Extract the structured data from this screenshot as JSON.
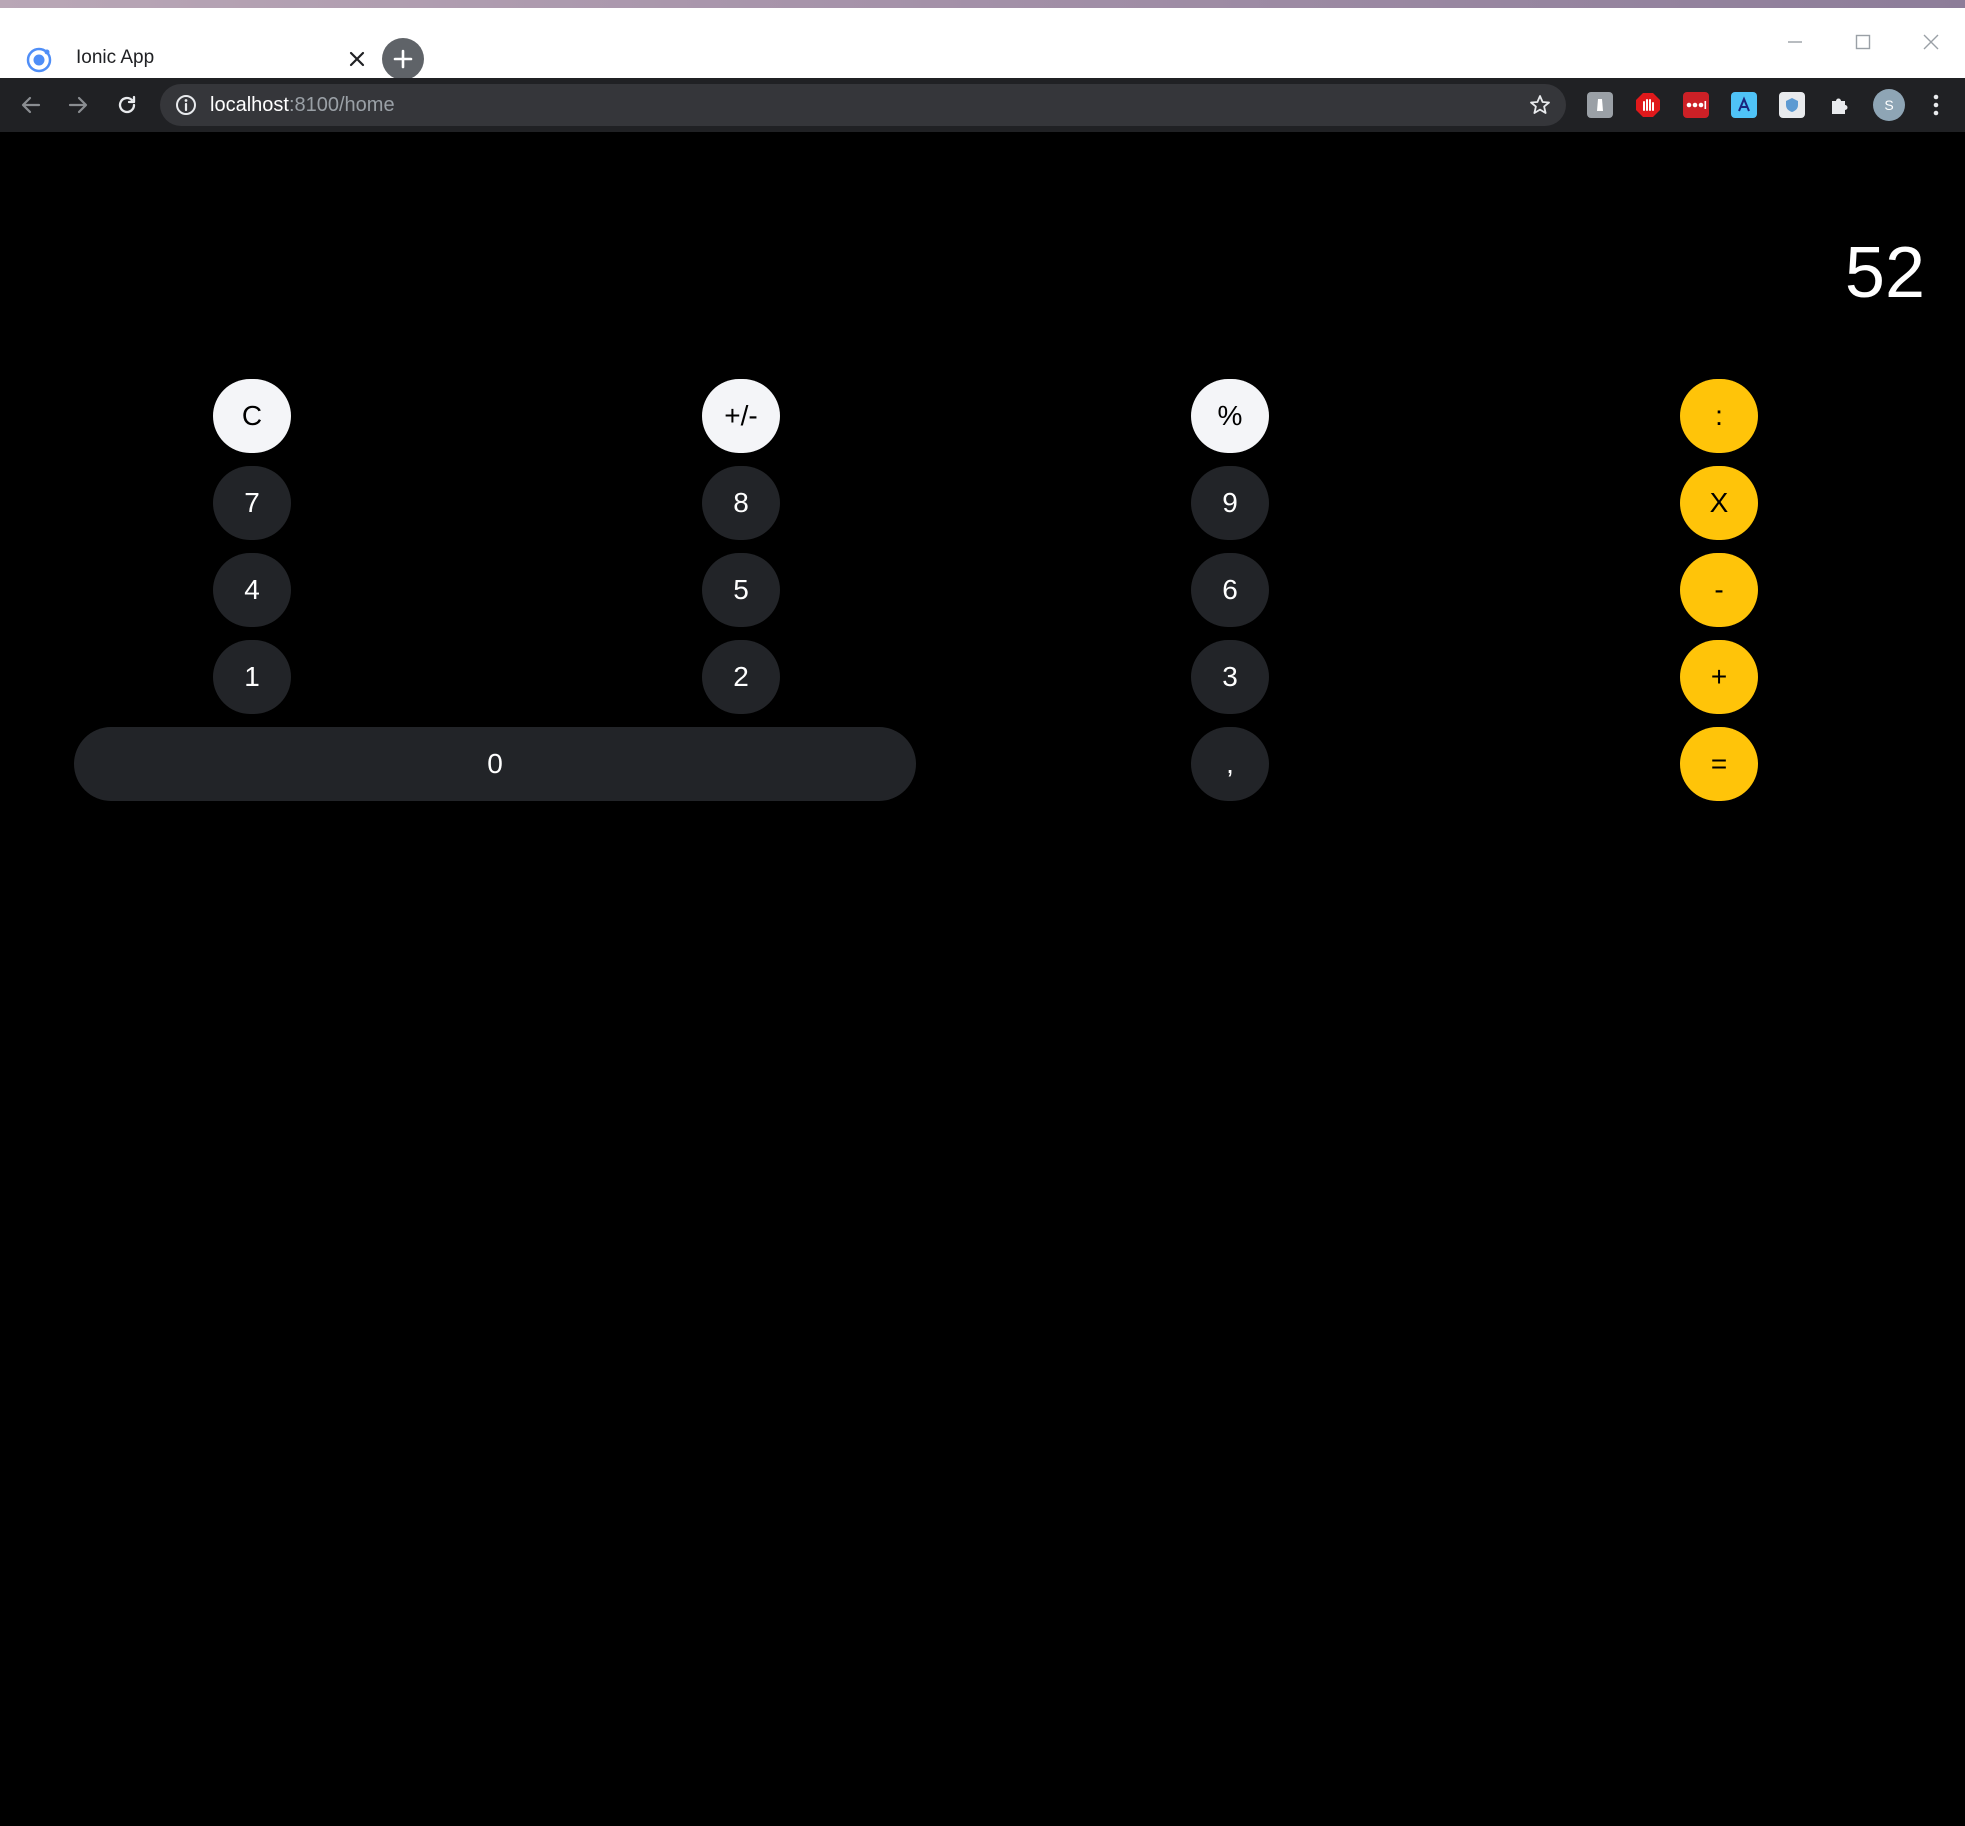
{
  "browser": {
    "tab_title": "Ionic App",
    "url_host": "localhost",
    "url_rest": ":8100/home",
    "profile_initial": "S",
    "extensions": [
      "lighthouse-icon",
      "adblock-icon",
      "lastpass-icon",
      "translate-icon",
      "privacy-badger-icon",
      "extensions-puzzle-icon"
    ]
  },
  "calculator": {
    "display": "52",
    "keys": {
      "clear": "C",
      "sign": "+/-",
      "percent": "%",
      "divide": ":",
      "seven": "7",
      "eight": "8",
      "nine": "9",
      "multiply": "X",
      "four": "4",
      "five": "5",
      "six": "6",
      "minus": "-",
      "one": "1",
      "two": "2",
      "three": "3",
      "plus": "+",
      "zero": "0",
      "decimal": ",",
      "equals": "="
    },
    "colors": {
      "function_key": "#f4f5f8",
      "digit_key": "#222428",
      "operator_key": "#ffc409"
    }
  }
}
